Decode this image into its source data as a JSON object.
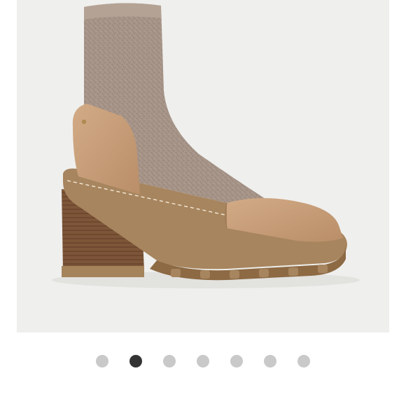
{
  "product_image": {
    "subject": "ankle-boot-knit-sock-block-heel",
    "colors": {
      "background": "#efefed",
      "knit": "#a8968a",
      "leather": "#c9a17c",
      "sole": "#9c7a52",
      "heel": "#7a5236"
    }
  },
  "carousel": {
    "total": 7,
    "active_index": 1,
    "colors": {
      "active": "#333333",
      "inactive": "#c9c9c9"
    }
  }
}
